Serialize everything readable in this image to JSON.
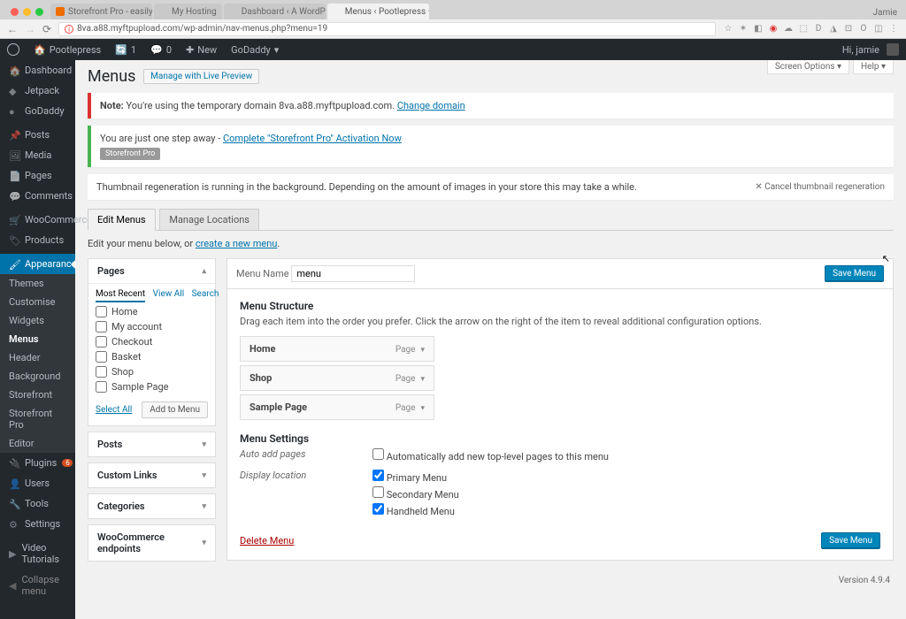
{
  "browser": {
    "user_label": "Jamie",
    "tabs": [
      {
        "title": "Storefront Pro - easily custo…"
      },
      {
        "title": "My Hosting"
      },
      {
        "title": "Dashboard ‹ A WordPress Sit…"
      },
      {
        "title": "Menus ‹ Pootlepress — Word…"
      }
    ],
    "url": "8va.a88.myftpupload.com/wp-admin/nav-menus.php?menu=19"
  },
  "adminbar": {
    "site": "Pootlepress",
    "updates": "1",
    "comments": "0",
    "new_label": "New",
    "godaddy": "GoDaddy",
    "greeting": "Hi, jamie"
  },
  "sidebar": {
    "items": [
      {
        "label": "Dashboard"
      },
      {
        "label": "Jetpack"
      },
      {
        "label": "GoDaddy"
      },
      {
        "label": "Posts"
      },
      {
        "label": "Media"
      },
      {
        "label": "Pages"
      },
      {
        "label": "Comments"
      },
      {
        "label": "WooCommerce"
      },
      {
        "label": "Products"
      },
      {
        "label": "Appearance"
      },
      {
        "label": "Plugins"
      },
      {
        "label": "Users"
      },
      {
        "label": "Tools"
      },
      {
        "label": "Settings"
      },
      {
        "label": "Video Tutorials"
      },
      {
        "label": "Collapse menu"
      }
    ],
    "plugins_badge": "6",
    "appearance_sub": [
      "Themes",
      "Customise",
      "Widgets",
      "Menus",
      "Header",
      "Background",
      "Storefront",
      "Storefront Pro",
      "Editor"
    ]
  },
  "page": {
    "title": "Menus",
    "live_preview": "Manage with Live Preview",
    "screen_options": "Screen Options ▾",
    "help": "Help ▾"
  },
  "notices": {
    "domain_note_lead": "Note: ",
    "domain_note_text": "You're using the temporary domain 8va.a88.myftpupload.com. ",
    "domain_note_link": "Change domain",
    "activation_lead": "You are just one step away - ",
    "activation_link": "Complete \"Storefront Pro\" Activation Now",
    "activation_badge": "Storefront Pro",
    "thumb_text": "Thumbnail regeneration is running in the background. Depending on the amount of images in your store this may take a while.",
    "thumb_cancel": "✕ Cancel thumbnail regeneration"
  },
  "tabs": {
    "edit": "Edit Menus",
    "locations": "Manage Locations"
  },
  "intro": {
    "text": "Edit your menu below, or ",
    "link": "create a new menu",
    "dot": "."
  },
  "left": {
    "pages": {
      "title": "Pages",
      "tab_recent": "Most Recent",
      "tab_all": "View All",
      "tab_search": "Search",
      "items": [
        "Home",
        "My account",
        "Checkout",
        "Basket",
        "Shop",
        "Sample Page"
      ],
      "select_all": "Select All",
      "add": "Add to Menu"
    },
    "panels": [
      "Posts",
      "Custom Links",
      "Categories",
      "WooCommerce endpoints"
    ]
  },
  "right": {
    "menu_name_label": "Menu Name",
    "menu_name_value": "menu",
    "save": "Save Menu",
    "structure_title": "Menu Structure",
    "structure_desc": "Drag each item into the order you prefer. Click the arrow on the right of the item to reveal additional configuration options.",
    "items": [
      {
        "label": "Home",
        "type": "Page"
      },
      {
        "label": "Shop",
        "type": "Page"
      },
      {
        "label": "Sample Page",
        "type": "Page"
      }
    ],
    "settings_title": "Menu Settings",
    "auto_label": "Auto add pages",
    "auto_opt": "Automatically add new top-level pages to this menu",
    "loc_label": "Display location",
    "loc_opts": [
      "Primary Menu",
      "Secondary Menu",
      "Handheld Menu"
    ],
    "delete": "Delete Menu"
  },
  "footer": {
    "version": "Version 4.9.4"
  }
}
